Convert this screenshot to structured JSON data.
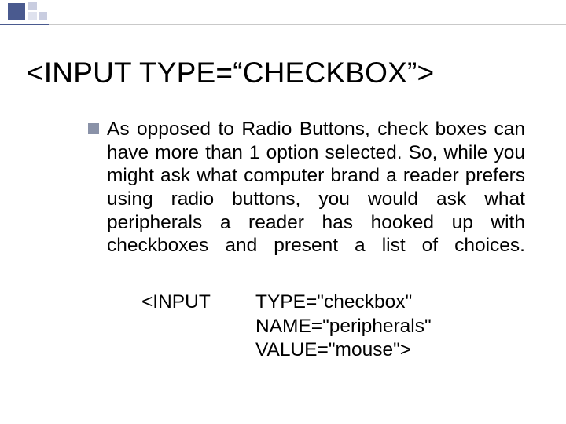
{
  "title": "<INPUT TYPE=“CHECKBOX”>",
  "bullet_text": "As opposed to Radio Buttons, check boxes can have more than 1 option selected. So, while you might ask what computer brand a reader prefers using radio buttons, you would ask what peripherals a reader has hooked up with checkboxes and present a list of choices.",
  "code": {
    "left": "<INPUT",
    "line1": "TYPE=\"checkbox\"",
    "line2": "NAME=\"peripherals\"",
    "line3": "VALUE=\"mouse\">"
  }
}
